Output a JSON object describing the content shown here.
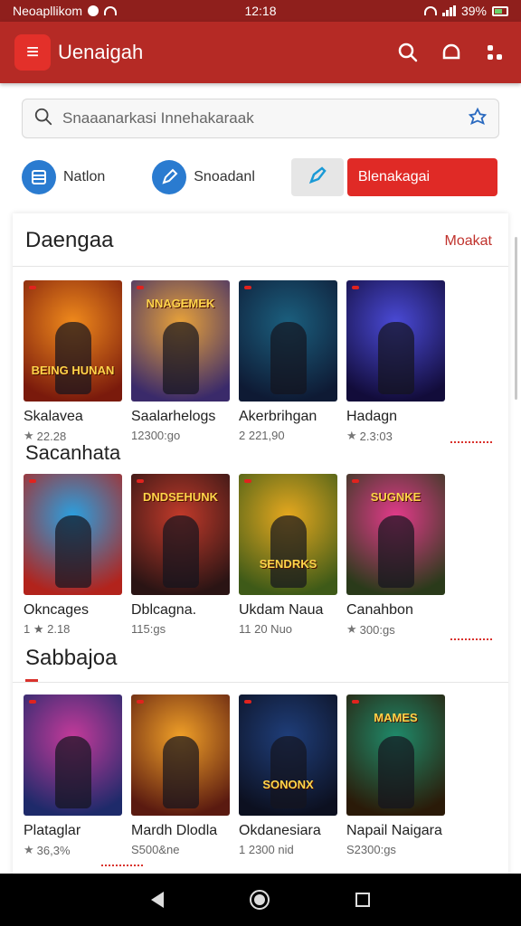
{
  "status_bar": {
    "carrier": "Neoapllikom",
    "time": "12:18",
    "battery": "39%"
  },
  "app_bar": {
    "logo_glyph": "≡",
    "title": "Uenaigah",
    "accent": "#b52a25"
  },
  "search": {
    "placeholder": "Snaaanarkasi Innehakaraak"
  },
  "quick": {
    "item1": "Natlon",
    "item2": "Snoadanl",
    "button": "Blenakagai"
  },
  "sections": [
    {
      "title": "Daengaa",
      "link": "Moakat",
      "tiles": [
        {
          "name": "Skalavea",
          "meta": "22.28",
          "star": true,
          "art": "BEING HUNAN",
          "colors": [
            "#f08a1c",
            "#7a1a0c"
          ]
        },
        {
          "name": "Saalarhelogs",
          "meta": "12300:go",
          "star": false,
          "art": "NNAGEMEK",
          "colors": [
            "#e8a23a",
            "#3a2a6a"
          ]
        },
        {
          "name": "Akerbrihgan",
          "meta": "2 221,90",
          "star": false,
          "art": "",
          "colors": [
            "#1b5f7e",
            "#0e1a34"
          ]
        },
        {
          "name": "Hadagn",
          "meta": "2.3:03",
          "star": true,
          "art": "",
          "colors": [
            "#4a4ad6",
            "#120c3a"
          ]
        }
      ]
    },
    {
      "title": "Sacanhata",
      "link": "",
      "tiles": [
        {
          "name": "Okncages",
          "meta": "1 ★ 2.18",
          "star": false,
          "art": "",
          "colors": [
            "#2aa0e0",
            "#b2231c"
          ]
        },
        {
          "name": "Dblcagna.",
          "meta": "115:gs",
          "star": false,
          "art": "DNDSEHUNK",
          "colors": [
            "#c13a2a",
            "#2a1414"
          ]
        },
        {
          "name": "Ukdam Naua",
          "meta": "11 20 Nuo",
          "star": false,
          "art": "SENDRKS",
          "colors": [
            "#e6a81f",
            "#3e5a18"
          ]
        },
        {
          "name": "Canahbon",
          "meta": "300:gs",
          "star": true,
          "art": "SUGNKE",
          "colors": [
            "#e23a8a",
            "#2a3a1a"
          ]
        }
      ]
    },
    {
      "title": "Sabbajoa",
      "link": "",
      "tiles": [
        {
          "name": "Plataglar",
          "meta": "36,3%",
          "star": true,
          "art": "",
          "colors": [
            "#c43a9a",
            "#1e2a6a"
          ]
        },
        {
          "name": "Mardh Dlodla",
          "meta": "S500&ne",
          "star": false,
          "art": "",
          "colors": [
            "#f0a028",
            "#5a1a10"
          ]
        },
        {
          "name": "Okdanesiara",
          "meta": "1 2300 nid",
          "star": false,
          "art": "SONONX",
          "colors": [
            "#1f3e7a",
            "#0c1020"
          ]
        },
        {
          "name": "Napail Naigara",
          "meta": "S2300:gs",
          "star": false,
          "art": "MAMES",
          "colors": [
            "#1f8a6a",
            "#2a1a08"
          ]
        }
      ]
    }
  ]
}
